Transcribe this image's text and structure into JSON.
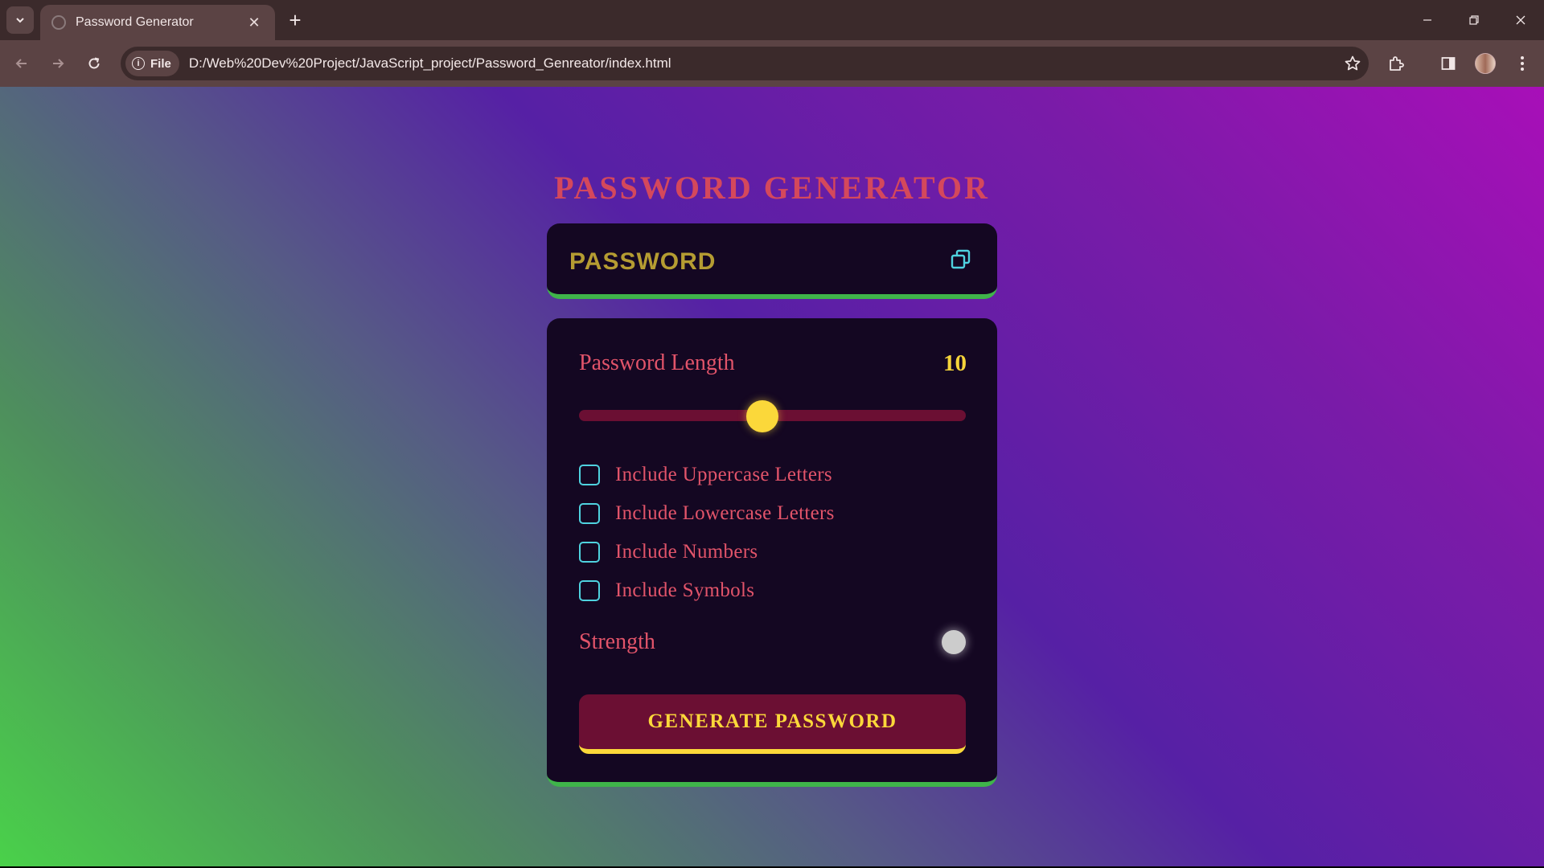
{
  "browser": {
    "tab_title": "Password Generator",
    "new_tab_symbol": "+",
    "close_symbol": "✕",
    "site_chip_label": "File",
    "url": "D:/Web%20Dev%20Project/JavaScript_project/Password_Genreator/index.html"
  },
  "page": {
    "title": "PASSWORD GENERATOR",
    "display": {
      "placeholder": "PASSWORD",
      "value": ""
    },
    "length": {
      "label": "Password Length",
      "value": "10",
      "slider_fraction": 0.475
    },
    "options": [
      {
        "label": "Include Uppercase Letters",
        "checked": false
      },
      {
        "label": "Include Lowercase Letters",
        "checked": false
      },
      {
        "label": "Include Numbers",
        "checked": false
      },
      {
        "label": "Include Symbols",
        "checked": false
      }
    ],
    "strength": {
      "label": "Strength",
      "indicator_color": "#cccccc"
    },
    "generate_label": "GENERATE PASSWORD"
  },
  "colors": {
    "accent_red": "#e2546a",
    "accent_yellow": "#fbd83a",
    "accent_green": "#3fb44a",
    "checkbox_cyan": "#4fd2df",
    "card_bg": "#140722"
  }
}
